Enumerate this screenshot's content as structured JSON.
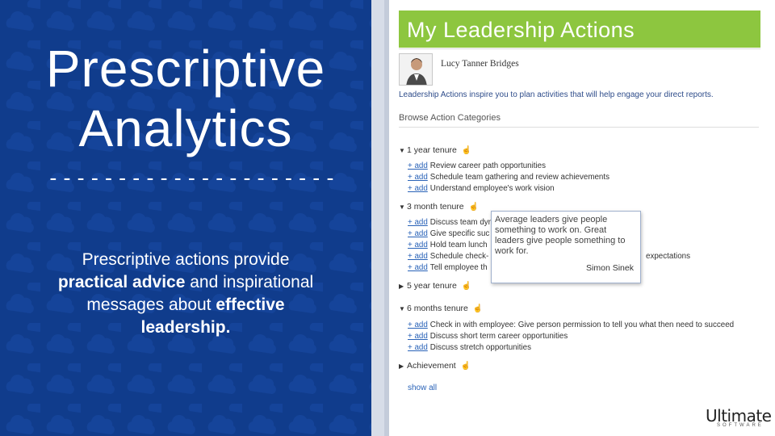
{
  "left": {
    "title_line1": "Prescriptive",
    "title_line2": "Analytics",
    "dashes": "---------------------",
    "body": {
      "part1": "Prescriptive actions provide ",
      "bold1": "practical advice",
      "part2": " and inspirational messages about ",
      "bold2": "effective leadership."
    }
  },
  "app": {
    "title": "My Leadership Actions",
    "user_name": "Lucy Tanner Bridges",
    "intro": "Leadership Actions inspire you to plan activities that will help engage your direct reports.",
    "browse_label": "Browse Action Categories",
    "add_label": "+ add",
    "categories": [
      {
        "label": "1 year tenure",
        "expanded": true,
        "actions": [
          "Review career path opportunities",
          "Schedule team gathering and review achievements",
          "Understand employee's work vision"
        ]
      },
      {
        "label": "3 month tenure",
        "expanded": true,
        "actions": [
          "Discuss team dyn",
          "Give specific suc",
          "Hold team lunch",
          "Schedule check-",
          "Tell employee th"
        ]
      },
      {
        "label": "5 year tenure",
        "expanded": false,
        "actions": []
      },
      {
        "label": "6 months tenure",
        "expanded": true,
        "actions": [
          "Check in with employee: Give person permission to tell you what then need to succeed",
          "Discuss short term career opportunities",
          "Discuss stretch opportunities"
        ]
      },
      {
        "label": "Achievement",
        "expanded": false,
        "actions": []
      }
    ],
    "behind_tooltip_text": "expectations",
    "show_all": "show all",
    "tooltip": {
      "quote": "Average leaders give people something to work on. Great leaders give people something to work for.",
      "author": "Simon Sinek"
    }
  },
  "logo": {
    "name": "Ultimate",
    "sub": "SOFTWARE"
  },
  "colors": {
    "left_bg": "#103c8c",
    "title_bar": "#8dc63f",
    "link": "#2a63b8"
  }
}
